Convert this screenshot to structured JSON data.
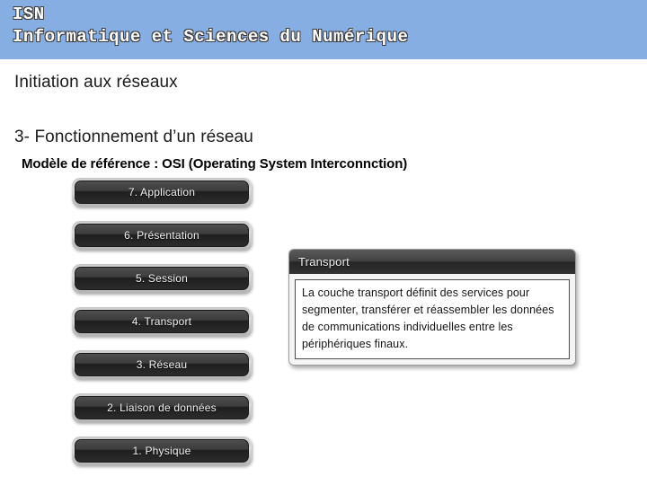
{
  "header": {
    "title_line1": "ISN",
    "title_line2": "Informatique et Sciences du Numérique",
    "background_color": "#86aee3",
    "text_color": "#ffffff"
  },
  "slide": {
    "lesson_title": "Initiation aux réseaux",
    "section_title": "3- Fonctionnement d’un réseau",
    "section_subtitle": "Modèle de référence : OSI (Operating System  Interconnction)",
    "background_color": "#ffffff"
  },
  "osi_model": {
    "layers": [
      {
        "label": "7. Application"
      },
      {
        "label": "6. Présentation"
      },
      {
        "label": "5. Session"
      },
      {
        "label": "4. Transport"
      },
      {
        "label": "3. Réseau"
      },
      {
        "label": "2. Liaison de données"
      },
      {
        "label": "1. Physique"
      }
    ]
  },
  "tooltip": {
    "title": "Transport",
    "body": "La couche transport définit des services pour segmenter, transférer et réassembler les données de communications individuelles entre les périphériques finaux."
  }
}
